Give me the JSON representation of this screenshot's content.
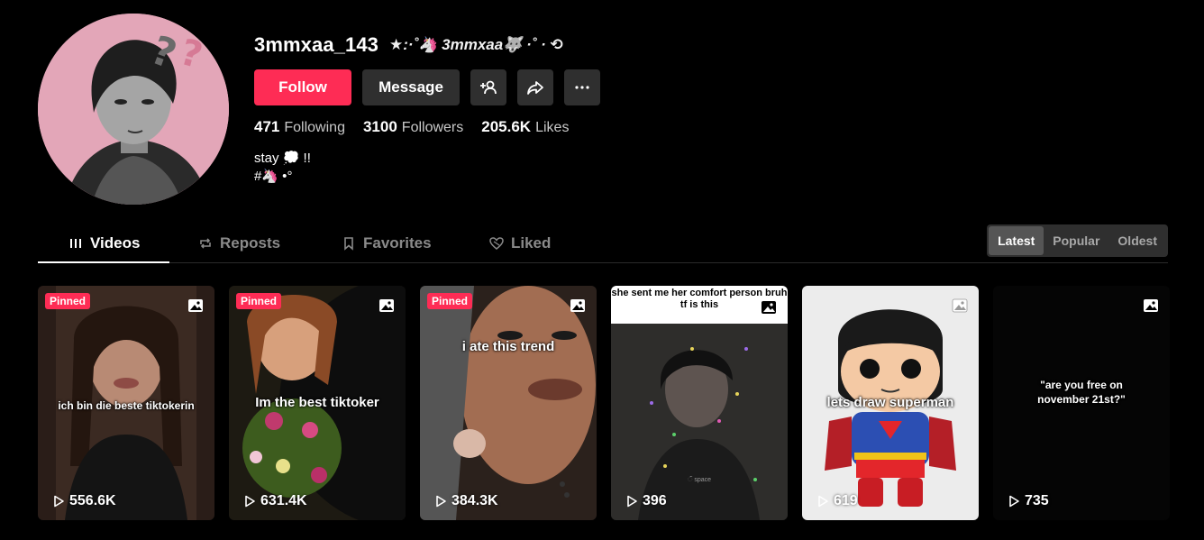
{
  "profile": {
    "username": "3mmxaa_143",
    "nickname": "★:·˚🦄 3mmxaa🐺 ·˚ · ⟲",
    "follow_label": "Follow",
    "message_label": "Message",
    "stats": {
      "following_count": "471",
      "following_label": "Following",
      "followers_count": "3100",
      "followers_label": "Followers",
      "likes_count": "205.6K",
      "likes_label": "Likes"
    },
    "bio_line1": "stay 💭 !!",
    "bio_line2": "#🦄 •°"
  },
  "tabs": [
    {
      "label": "Videos",
      "icon": "grid-icon",
      "active": true
    },
    {
      "label": "Reposts",
      "icon": "repost-icon"
    },
    {
      "label": "Favorites",
      "icon": "bookmark-icon"
    },
    {
      "label": "Liked",
      "icon": "heart-icon"
    }
  ],
  "sort_options": [
    "Latest",
    "Popular",
    "Oldest"
  ],
  "sort_selected": "Latest",
  "videos": [
    {
      "pinned_label": "Pinned",
      "caption": "ich bin die beste tiktokerin",
      "views": "556.6K"
    },
    {
      "pinned_label": "Pinned",
      "caption": "Im the best tiktoker",
      "views": "631.4K"
    },
    {
      "pinned_label": "Pinned",
      "caption": "i ate this trend",
      "views": "384.3K"
    },
    {
      "caption": "she sent me her comfort person bruh tf is this",
      "overlay_text": "ଁ space",
      "views": "396"
    },
    {
      "caption": "lets draw superman",
      "views": "619"
    },
    {
      "caption": "\"are you free on november 21st?\"",
      "views": "735"
    }
  ],
  "colors": {
    "accent": "#fe2c55",
    "button_bg": "#2f2f2f",
    "background": "#000000"
  }
}
